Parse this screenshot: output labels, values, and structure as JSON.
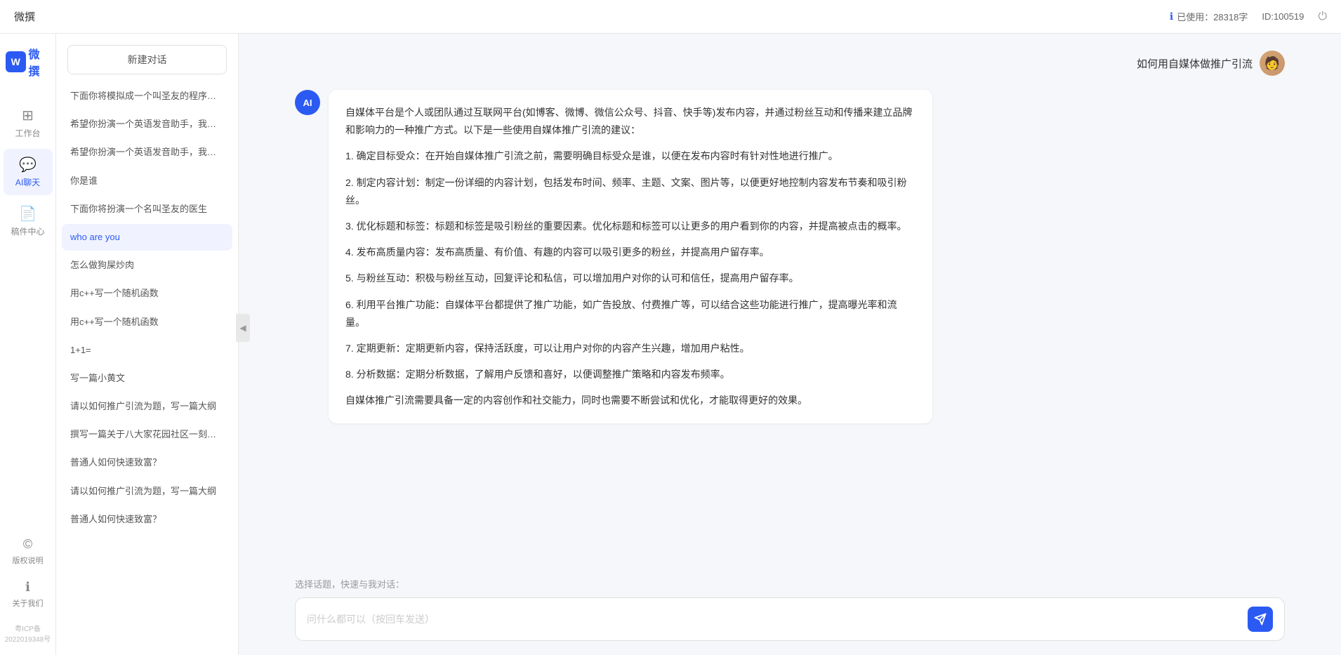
{
  "topbar": {
    "title": "微撰",
    "usage_label": "已使用：28318字",
    "id_label": "ID:100519",
    "usage_icon": "ℹ"
  },
  "left_nav": {
    "logo_w": "W",
    "logo_text": "微撰",
    "items": [
      {
        "id": "workspace",
        "label": "工作台",
        "icon": "⊞"
      },
      {
        "id": "ai-chat",
        "label": "AI聊天",
        "icon": "💬",
        "active": true
      },
      {
        "id": "mailbox",
        "label": "稿件中心",
        "icon": "📄"
      }
    ],
    "bottom_items": [
      {
        "id": "copyright",
        "label": "版权说明",
        "icon": "©"
      },
      {
        "id": "about",
        "label": "关于我们",
        "icon": "ℹ"
      }
    ],
    "icp": "粤ICP备2022019348号"
  },
  "history": {
    "new_chat_label": "新建对话",
    "items": [
      {
        "id": "h1",
        "text": "下面你将模拟成一个叫圣友的程序员，我说...",
        "active": false
      },
      {
        "id": "h2",
        "text": "希望你扮演一个英语发音助手，我提供给你...",
        "active": false
      },
      {
        "id": "h3",
        "text": "希望你扮演一个英语发音助手，我提供给你...",
        "active": false
      },
      {
        "id": "h4",
        "text": "你是谁",
        "active": false
      },
      {
        "id": "h5",
        "text": "下面你将扮演一个名叫圣友的医生",
        "active": false
      },
      {
        "id": "h6",
        "text": "who are you",
        "active": true
      },
      {
        "id": "h7",
        "text": "怎么做狗屎炒肉",
        "active": false
      },
      {
        "id": "h8",
        "text": "用c++写一个随机函数",
        "active": false
      },
      {
        "id": "h9",
        "text": "用c++写一个随机函数",
        "active": false
      },
      {
        "id": "h10",
        "text": "1+1=",
        "active": false
      },
      {
        "id": "h11",
        "text": "写一篇小黄文",
        "active": false
      },
      {
        "id": "h12",
        "text": "请以如何推广引流为题，写一篇大纲",
        "active": false
      },
      {
        "id": "h13",
        "text": "撰写一篇关于八大家花园社区一刻钟便民生...",
        "active": false
      },
      {
        "id": "h14",
        "text": "普通人如何快速致富？",
        "active": false
      },
      {
        "id": "h15",
        "text": "请以如何推广引流为题，写一篇大纲",
        "active": false
      },
      {
        "id": "h16",
        "text": "普通人如何快速致富？",
        "active": false
      }
    ]
  },
  "chat": {
    "user_question": "如何用自媒体做推广引流",
    "ai_response": {
      "paragraphs": [
        "自媒体平台是个人或团队通过互联网平台(如博客、微博、微信公众号、抖音、快手等)发布内容，并通过粉丝互动和传播来建立品牌和影响力的一种推广方式。以下是一些使用自媒体推广引流的建议：",
        "1. 确定目标受众：在开始自媒体推广引流之前，需要明确目标受众是谁，以便在发布内容时有针对性地进行推广。",
        "2. 制定内容计划：制定一份详细的内容计划，包括发布时间、频率、主题、文案、图片等，以便更好地控制内容发布节奏和吸引粉丝。",
        "3. 优化标题和标签：标题和标签是吸引粉丝的重要因素。优化标题和标签可以让更多的用户看到你的内容，并提高被点击的概率。",
        "4. 发布高质量内容：发布高质量、有价值、有趣的内容可以吸引更多的粉丝，并提高用户留存率。",
        "5. 与粉丝互动：积极与粉丝互动，回复评论和私信，可以增加用户对你的认可和信任，提高用户留存率。",
        "6. 利用平台推广功能：自媒体平台都提供了推广功能，如广告投放、付费推广等，可以结合这些功能进行推广，提高曝光率和流量。",
        "7. 定期更新：定期更新内容，保持活跃度，可以让用户对你的内容产生兴趣，增加用户粘性。",
        "8. 分析数据：定期分析数据，了解用户反馈和喜好，以便调整推广策略和内容发布频率。",
        "自媒体推广引流需要具备一定的内容创作和社交能力，同时也需要不断尝试和优化，才能取得更好的效果。"
      ]
    },
    "input_placeholder": "问什么都可以（按回车发送）",
    "quick_topic_label": "选择话题，快速与我对话："
  }
}
